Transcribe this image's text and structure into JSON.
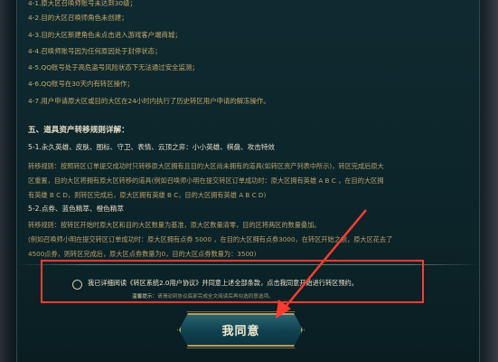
{
  "rules_list": [
    "4-1.原大区召唤师账号未达到30级；",
    "4-2.目的大区召唤师角色未创建；",
    "4-3.目的大区新建角色未点击进入游戏客户端商城；",
    "4-4.召唤师账号因为任何原因处于封停状态；",
    "4-5.QQ账号处于高危盗号风险状态下无法通过安全监测；",
    "4-6.QQ账号在30天内有转区操作；",
    "4-7.用户申请原大区或目的大区在24小时内执行了历史转区用户申请的解冻操作。"
  ],
  "section": {
    "title": "五、道具资产转移规则详解：",
    "sub1": "5-1.永久英雄、皮肤、图标、守卫、表情、云顶之弈：小小英雄、棋盘、攻击特效",
    "para1": [
      "转移规则：按照转区订单提交成功时只转移原大区拥有且目的大区尚未拥有的道具(如转区资产列表中所示)，转区完成后原大",
      "区重置，目的大区将拥有原大区转移的道具(例如召唤师小明在提交转区订单成功时：原大区拥有英雄 A B C ，在目的大区拥",
      "有英雄 B C D，则转区完成后，原大区拥有英雄 B C，目的大区拥有英雄 A B C D)"
    ],
    "sub2": "5-2.点券、蓝色精萃、橙色精萃",
    "para2": [
      "转移规则：按转区开始时原大区和目的大区数量为基准，原大区数量清零，目的区将两区的数量叠加。",
      "(例如召唤师小明在提交转区订单成功时：原大区拥有点券 5000 ，在目的大区拥有点券3000，在转区开始之前，原大区花去了",
      "4500点券，则转区完成后，原大区点券数量为0，目的大区点券数量为：3500)"
    ]
  },
  "consent": {
    "text": "我已详细阅读《转区系统2.0用户协议》并同意上述全部条款，点击我同意开始进行转区预约。",
    "tip_label": "温馨提示：",
    "tip_text": "请滑动到协议底部完成全文阅读后再勾选同意选项。"
  },
  "agree_button_label": "我同意",
  "colors": {
    "accent_gold": "#c5a968",
    "highlight_red": "#ff3b30",
    "button_teal": "#0f4150"
  }
}
